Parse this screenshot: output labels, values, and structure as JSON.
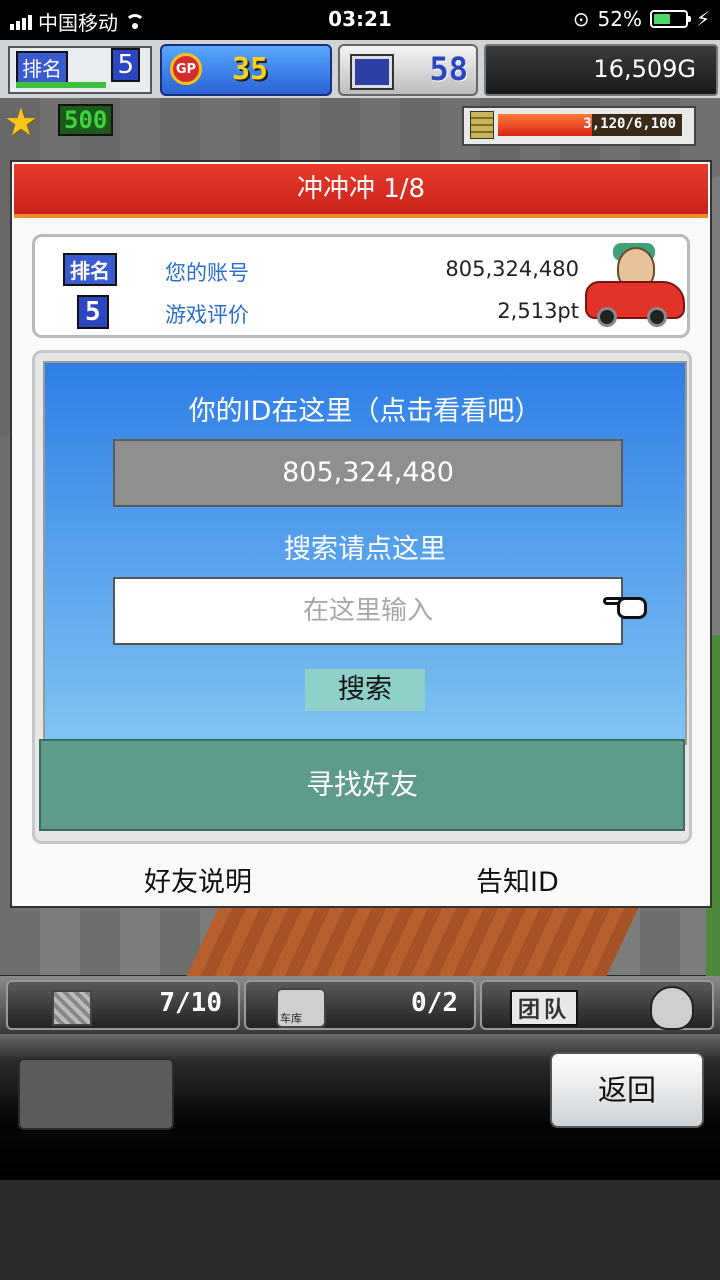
{
  "status_bar": {
    "carrier": "中国移动",
    "time": "03:21",
    "battery_percent": "52%",
    "battery_level": 0.52
  },
  "hud": {
    "rank_label": "排名",
    "rank_value": "5",
    "gp_label": "GP",
    "gp_value": "35",
    "pc_value": "58",
    "money": "16,509G",
    "stars": "500",
    "resource_text": "3,120/6,100",
    "resource_fraction": 0.511
  },
  "dialog": {
    "title": "冲冲冲 1/8",
    "info": {
      "rank_label": "排名",
      "rank_value": "5",
      "account_label": "您的账号",
      "account_value": "805,324,480",
      "rating_label": "游戏评价",
      "rating_value": "2,513pt"
    },
    "id_label": "你的ID在这里（点击看看吧）",
    "id_value": "805,324,480",
    "search_label": "搜索请点这里",
    "search_placeholder": "在这里输入",
    "search_button": "搜索",
    "find_friend_button": "寻找好友",
    "friend_help_link": "好友说明",
    "tell_id_link": "告知ID"
  },
  "bottom": {
    "tab1_counter": "7/10",
    "tab2_icon_label": "车库",
    "tab2_counter": "0/2",
    "team_label": "团队",
    "back_button": "返回"
  }
}
